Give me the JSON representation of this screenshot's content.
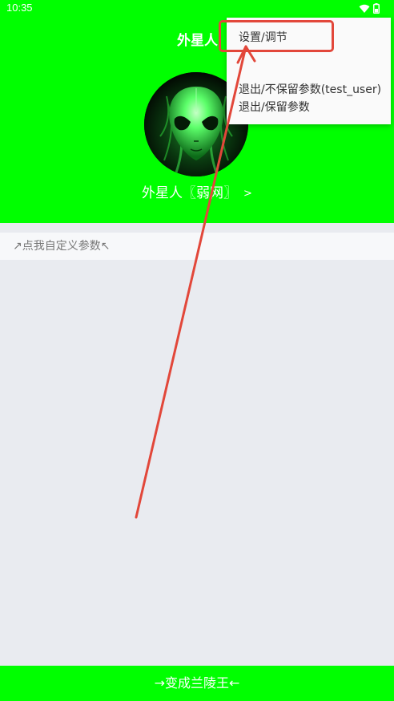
{
  "status_bar": {
    "time": "10:35",
    "icons": [
      "wifi-icon",
      "battery-icon"
    ]
  },
  "header": {
    "title": "外星人",
    "username": "外星人〖弱网〗",
    "chevron": ">",
    "avatar_icon": "alien-avatar",
    "background_color": "#00ff00"
  },
  "custom_params": {
    "label": "↗点我自定义参数↖"
  },
  "dropdown_menu": {
    "items": [
      {
        "label": "设置/调节"
      },
      {
        "label": "退出/不保留参数(test_user)"
      },
      {
        "label": "退出/保留参数"
      }
    ]
  },
  "bottom_button": {
    "label": "→变成兰陵王←"
  },
  "annotation": {
    "color": "#e2473a"
  }
}
